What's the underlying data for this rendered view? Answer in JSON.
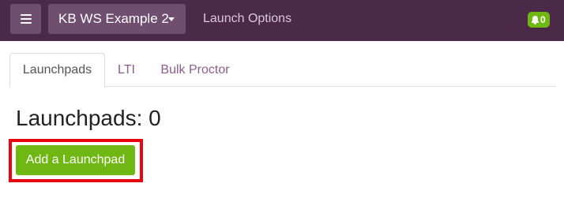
{
  "navbar": {
    "workspace_label": "KB WS Example 2",
    "launch_options_label": "Launch Options",
    "notification_count": "0"
  },
  "tabs": [
    {
      "label": "Launchpads",
      "active": true
    },
    {
      "label": "LTI",
      "active": false
    },
    {
      "label": "Bulk Proctor",
      "active": false
    }
  ],
  "main": {
    "heading": "Launchpads: 0",
    "add_button_label": "Add a Launchpad"
  },
  "icons": {
    "menu": "hamburger-icon",
    "workspace_dropdown": "caret-down-icon",
    "notifications": "bell-icon"
  },
  "colors": {
    "navbar_bg": "#4a2a48",
    "nav_button_bg": "#6f4e70",
    "accent_green": "#6fb712",
    "tab_link": "#8a5d8c",
    "highlight_red": "#e8060f"
  }
}
